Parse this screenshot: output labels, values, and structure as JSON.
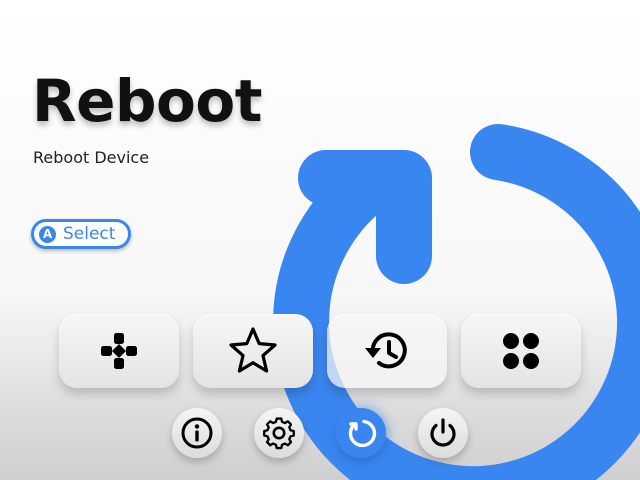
{
  "screen": {
    "title": "Reboot",
    "subtitle": "Reboot Device"
  },
  "hint": {
    "button_glyph": "A",
    "label": "Select"
  },
  "colors": {
    "accent": "#3a86f0",
    "text": "#111111"
  },
  "menu_tiles": [
    {
      "icon": "gamepad-icon",
      "selected": false
    },
    {
      "icon": "star-icon",
      "selected": false
    },
    {
      "icon": "history-icon",
      "selected": true
    },
    {
      "icon": "apps-grid-icon",
      "selected": false
    }
  ],
  "system_buttons": [
    {
      "icon": "info-icon",
      "active": false
    },
    {
      "icon": "gear-icon",
      "active": false
    },
    {
      "icon": "reboot-icon",
      "active": true
    },
    {
      "icon": "power-icon",
      "active": false
    }
  ]
}
